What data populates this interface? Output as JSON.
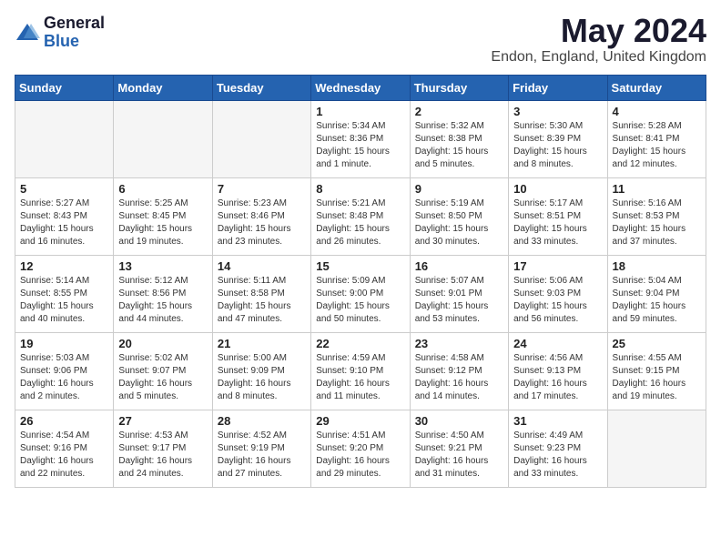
{
  "logo": {
    "general": "General",
    "blue": "Blue"
  },
  "title": {
    "month": "May 2024",
    "location": "Endon, England, United Kingdom"
  },
  "weekdays": [
    "Sunday",
    "Monday",
    "Tuesday",
    "Wednesday",
    "Thursday",
    "Friday",
    "Saturday"
  ],
  "days": [
    {
      "num": "",
      "info": ""
    },
    {
      "num": "",
      "info": ""
    },
    {
      "num": "",
      "info": ""
    },
    {
      "num": "1",
      "info": "Sunrise: 5:34 AM\nSunset: 8:36 PM\nDaylight: 15 hours\nand 1 minute."
    },
    {
      "num": "2",
      "info": "Sunrise: 5:32 AM\nSunset: 8:38 PM\nDaylight: 15 hours\nand 5 minutes."
    },
    {
      "num": "3",
      "info": "Sunrise: 5:30 AM\nSunset: 8:39 PM\nDaylight: 15 hours\nand 8 minutes."
    },
    {
      "num": "4",
      "info": "Sunrise: 5:28 AM\nSunset: 8:41 PM\nDaylight: 15 hours\nand 12 minutes."
    },
    {
      "num": "5",
      "info": "Sunrise: 5:27 AM\nSunset: 8:43 PM\nDaylight: 15 hours\nand 16 minutes."
    },
    {
      "num": "6",
      "info": "Sunrise: 5:25 AM\nSunset: 8:45 PM\nDaylight: 15 hours\nand 19 minutes."
    },
    {
      "num": "7",
      "info": "Sunrise: 5:23 AM\nSunset: 8:46 PM\nDaylight: 15 hours\nand 23 minutes."
    },
    {
      "num": "8",
      "info": "Sunrise: 5:21 AM\nSunset: 8:48 PM\nDaylight: 15 hours\nand 26 minutes."
    },
    {
      "num": "9",
      "info": "Sunrise: 5:19 AM\nSunset: 8:50 PM\nDaylight: 15 hours\nand 30 minutes."
    },
    {
      "num": "10",
      "info": "Sunrise: 5:17 AM\nSunset: 8:51 PM\nDaylight: 15 hours\nand 33 minutes."
    },
    {
      "num": "11",
      "info": "Sunrise: 5:16 AM\nSunset: 8:53 PM\nDaylight: 15 hours\nand 37 minutes."
    },
    {
      "num": "12",
      "info": "Sunrise: 5:14 AM\nSunset: 8:55 PM\nDaylight: 15 hours\nand 40 minutes."
    },
    {
      "num": "13",
      "info": "Sunrise: 5:12 AM\nSunset: 8:56 PM\nDaylight: 15 hours\nand 44 minutes."
    },
    {
      "num": "14",
      "info": "Sunrise: 5:11 AM\nSunset: 8:58 PM\nDaylight: 15 hours\nand 47 minutes."
    },
    {
      "num": "15",
      "info": "Sunrise: 5:09 AM\nSunset: 9:00 PM\nDaylight: 15 hours\nand 50 minutes."
    },
    {
      "num": "16",
      "info": "Sunrise: 5:07 AM\nSunset: 9:01 PM\nDaylight: 15 hours\nand 53 minutes."
    },
    {
      "num": "17",
      "info": "Sunrise: 5:06 AM\nSunset: 9:03 PM\nDaylight: 15 hours\nand 56 minutes."
    },
    {
      "num": "18",
      "info": "Sunrise: 5:04 AM\nSunset: 9:04 PM\nDaylight: 15 hours\nand 59 minutes."
    },
    {
      "num": "19",
      "info": "Sunrise: 5:03 AM\nSunset: 9:06 PM\nDaylight: 16 hours\nand 2 minutes."
    },
    {
      "num": "20",
      "info": "Sunrise: 5:02 AM\nSunset: 9:07 PM\nDaylight: 16 hours\nand 5 minutes."
    },
    {
      "num": "21",
      "info": "Sunrise: 5:00 AM\nSunset: 9:09 PM\nDaylight: 16 hours\nand 8 minutes."
    },
    {
      "num": "22",
      "info": "Sunrise: 4:59 AM\nSunset: 9:10 PM\nDaylight: 16 hours\nand 11 minutes."
    },
    {
      "num": "23",
      "info": "Sunrise: 4:58 AM\nSunset: 9:12 PM\nDaylight: 16 hours\nand 14 minutes."
    },
    {
      "num": "24",
      "info": "Sunrise: 4:56 AM\nSunset: 9:13 PM\nDaylight: 16 hours\nand 17 minutes."
    },
    {
      "num": "25",
      "info": "Sunrise: 4:55 AM\nSunset: 9:15 PM\nDaylight: 16 hours\nand 19 minutes."
    },
    {
      "num": "26",
      "info": "Sunrise: 4:54 AM\nSunset: 9:16 PM\nDaylight: 16 hours\nand 22 minutes."
    },
    {
      "num": "27",
      "info": "Sunrise: 4:53 AM\nSunset: 9:17 PM\nDaylight: 16 hours\nand 24 minutes."
    },
    {
      "num": "28",
      "info": "Sunrise: 4:52 AM\nSunset: 9:19 PM\nDaylight: 16 hours\nand 27 minutes."
    },
    {
      "num": "29",
      "info": "Sunrise: 4:51 AM\nSunset: 9:20 PM\nDaylight: 16 hours\nand 29 minutes."
    },
    {
      "num": "30",
      "info": "Sunrise: 4:50 AM\nSunset: 9:21 PM\nDaylight: 16 hours\nand 31 minutes."
    },
    {
      "num": "31",
      "info": "Sunrise: 4:49 AM\nSunset: 9:23 PM\nDaylight: 16 hours\nand 33 minutes."
    },
    {
      "num": "",
      "info": ""
    }
  ]
}
